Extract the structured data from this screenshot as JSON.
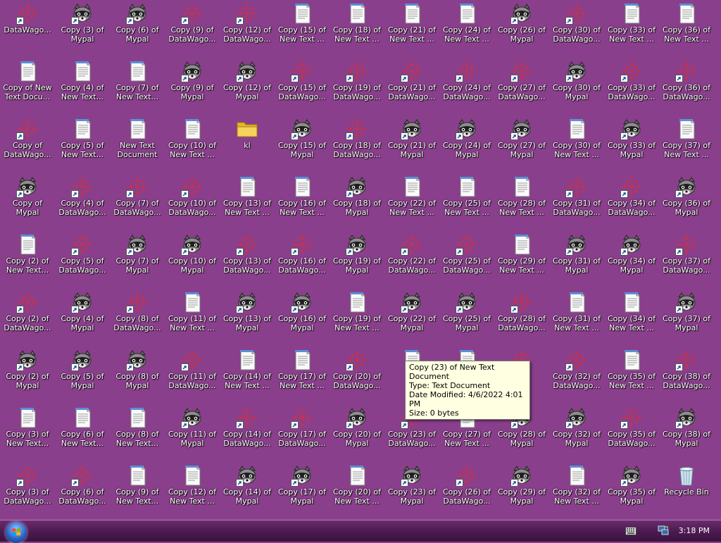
{
  "desktop": {
    "columns": [
      [
        {
          "label": "DataWago...",
          "type": "datawagon"
        },
        {
          "label": "Copy of New Text Docu...",
          "type": "text"
        },
        {
          "label": "Copy of DataWago...",
          "type": "datawagon"
        },
        {
          "label": "Copy of Mypal",
          "type": "mypal"
        },
        {
          "label": "Copy (2) of New Text...",
          "type": "text"
        },
        {
          "label": "Copy (2) of DataWago...",
          "type": "datawagon"
        },
        {
          "label": "Copy (2) of Mypal",
          "type": "mypal"
        },
        {
          "label": "Copy (3) of New Text...",
          "type": "text"
        },
        {
          "label": "Copy (3) of DataWago...",
          "type": "datawagon"
        }
      ],
      [
        {
          "label": "Copy (3) of Mypal",
          "type": "mypal"
        },
        {
          "label": "Copy (4) of New Text...",
          "type": "text"
        },
        {
          "label": "Copy (5) of New Text...",
          "type": "text"
        },
        {
          "label": "Copy (4) of DataWago...",
          "type": "datawagon"
        },
        {
          "label": "Copy (5) of DataWago...",
          "type": "datawagon"
        },
        {
          "label": "Copy (4) of Mypal",
          "type": "mypal"
        },
        {
          "label": "Copy (5) of Mypal",
          "type": "mypal"
        },
        {
          "label": "Copy (6) of New Text...",
          "type": "text"
        },
        {
          "label": "Copy (6) of DataWago...",
          "type": "datawagon"
        }
      ],
      [
        {
          "label": "Copy (6) of Mypal",
          "type": "mypal"
        },
        {
          "label": "Copy (7) of New Text...",
          "type": "text"
        },
        {
          "label": "New Text Document",
          "type": "text"
        },
        {
          "label": "Copy (7) of DataWago...",
          "type": "datawagon"
        },
        {
          "label": "Copy (7) of Mypal",
          "type": "mypal"
        },
        {
          "label": "Copy (8) of DataWago...",
          "type": "datawagon"
        },
        {
          "label": "Copy (8) of Mypal",
          "type": "mypal"
        },
        {
          "label": "Copy (8) of New Text...",
          "type": "text"
        },
        {
          "label": "Copy (9) of New Text...",
          "type": "text"
        }
      ],
      [
        {
          "label": "Copy (9) of DataWago...",
          "type": "datawagon"
        },
        {
          "label": "Copy (9) of Mypal",
          "type": "mypal"
        },
        {
          "label": "Copy (10) of New Text ...",
          "type": "text"
        },
        {
          "label": "Copy (10) of DataWago...",
          "type": "datawagon"
        },
        {
          "label": "Copy (10) of Mypal",
          "type": "mypal"
        },
        {
          "label": "Copy (11) of New Text ...",
          "type": "text"
        },
        {
          "label": "Copy (11) of DataWago...",
          "type": "datawagon"
        },
        {
          "label": "Copy (11) of Mypal",
          "type": "mypal"
        },
        {
          "label": "Copy (12) of New Text ...",
          "type": "text"
        }
      ],
      [
        {
          "label": "Copy (12) of DataWago...",
          "type": "datawagon"
        },
        {
          "label": "Copy (12) of Mypal",
          "type": "mypal"
        },
        {
          "label": "kl",
          "type": "folder"
        },
        {
          "label": "Copy (13) of New Text ...",
          "type": "text"
        },
        {
          "label": "Copy (13) of DataWago...",
          "type": "datawagon"
        },
        {
          "label": "Copy (13) of Mypal",
          "type": "mypal"
        },
        {
          "label": "Copy (14) of New Text ...",
          "type": "text"
        },
        {
          "label": "Copy (14) of DataWago...",
          "type": "datawagon"
        },
        {
          "label": "Copy (14) of Mypal",
          "type": "mypal"
        }
      ],
      [
        {
          "label": "Copy (15) of New Text ...",
          "type": "text"
        },
        {
          "label": "Copy (15) of DataWago...",
          "type": "datawagon"
        },
        {
          "label": "Copy (15) of Mypal",
          "type": "mypal"
        },
        {
          "label": "Copy (16) of New Text ...",
          "type": "text"
        },
        {
          "label": "Copy (16) of DataWago...",
          "type": "datawagon"
        },
        {
          "label": "Copy (16) of Mypal",
          "type": "mypal"
        },
        {
          "label": "Copy (17) of New Text ...",
          "type": "text"
        },
        {
          "label": "Copy (17) of DataWago...",
          "type": "datawagon"
        },
        {
          "label": "Copy (17) of Mypal",
          "type": "mypal"
        }
      ],
      [
        {
          "label": "Copy (18) of New Text ...",
          "type": "text"
        },
        {
          "label": "Copy (19) of DataWago...",
          "type": "datawagon"
        },
        {
          "label": "Copy (18) of DataWago...",
          "type": "datawagon"
        },
        {
          "label": "Copy (18) of Mypal",
          "type": "mypal"
        },
        {
          "label": "Copy (19) of Mypal",
          "type": "mypal"
        },
        {
          "label": "Copy (19) of New Text ...",
          "type": "text"
        },
        {
          "label": "Copy (20) of DataWago...",
          "type": "datawagon"
        },
        {
          "label": "Copy (20) of Mypal",
          "type": "mypal"
        },
        {
          "label": "Copy (20) of New Text ...",
          "type": "text"
        }
      ],
      [
        {
          "label": "Copy (21) of New Text ...",
          "type": "text"
        },
        {
          "label": "Copy (21) of DataWago...",
          "type": "datawagon"
        },
        {
          "label": "Copy (21) of Mypal",
          "type": "mypal"
        },
        {
          "label": "Copy (22) of New Text ...",
          "type": "text"
        },
        {
          "label": "Copy (22) of DataWago...",
          "type": "datawagon"
        },
        {
          "label": "Copy (22) of Mypal",
          "type": "mypal"
        },
        {
          "label": "",
          "type": "text"
        },
        {
          "label": "Copy (23) of DataWago...",
          "type": "datawagon"
        },
        {
          "label": "Copy (23) of Mypal",
          "type": "mypal"
        }
      ],
      [
        {
          "label": "Copy (24) of New Text ...",
          "type": "text"
        },
        {
          "label": "Copy (24) of DataWago...",
          "type": "datawagon"
        },
        {
          "label": "Copy (24) of Mypal",
          "type": "mypal"
        },
        {
          "label": "Copy (25) of New Text ...",
          "type": "text"
        },
        {
          "label": "Copy (25) of DataWago...",
          "type": "datawagon"
        },
        {
          "label": "Copy (25) of Mypal",
          "type": "mypal"
        },
        {
          "label": "",
          "type": "text"
        },
        {
          "label": "Copy (27) of New Text ...",
          "type": "text"
        },
        {
          "label": "Copy (26) of DataWago...",
          "type": "datawagon"
        }
      ],
      [
        {
          "label": "Copy (26) of Mypal",
          "type": "mypal"
        },
        {
          "label": "Copy (27) of DataWago...",
          "type": "datawagon"
        },
        {
          "label": "Copy (27) of Mypal",
          "type": "mypal"
        },
        {
          "label": "Copy (28) of New Text ...",
          "type": "text"
        },
        {
          "label": "Copy (29) of New Text ...",
          "type": "text"
        },
        {
          "label": "Copy (28) of DataWago...",
          "type": "datawagon"
        },
        {
          "label": "",
          "type": "datawagon"
        },
        {
          "label": "Copy (28) of Mypal",
          "type": "mypal"
        },
        {
          "label": "Copy (29) of Mypal",
          "type": "mypal"
        }
      ],
      [
        {
          "label": "Copy (30) of DataWago...",
          "type": "datawagon"
        },
        {
          "label": "Copy (30) of Mypal",
          "type": "mypal"
        },
        {
          "label": "Copy (30) of New Text ...",
          "type": "text"
        },
        {
          "label": "Copy (31) of DataWago...",
          "type": "datawagon"
        },
        {
          "label": "Copy (31) of Mypal",
          "type": "mypal"
        },
        {
          "label": "Copy (31) of New Text ...",
          "type": "text"
        },
        {
          "label": "Copy (32) of DataWago...",
          "type": "datawagon"
        },
        {
          "label": "Copy (32) of Mypal",
          "type": "mypal"
        },
        {
          "label": "Copy (32) of New Text ...",
          "type": "text"
        }
      ],
      [
        {
          "label": "Copy (33) of New Text ...",
          "type": "text"
        },
        {
          "label": "Copy (33) of DataWago...",
          "type": "datawagon"
        },
        {
          "label": "Copy (33) of Mypal",
          "type": "mypal"
        },
        {
          "label": "Copy (34) of DataWago...",
          "type": "datawagon"
        },
        {
          "label": "Copy (34) of Mypal",
          "type": "mypal"
        },
        {
          "label": "Copy (34) of New Text ...",
          "type": "text"
        },
        {
          "label": "Copy (35) of New Text ...",
          "type": "text"
        },
        {
          "label": "Copy (35) of DataWago...",
          "type": "datawagon"
        },
        {
          "label": "Copy (35) of Mypal",
          "type": "mypal"
        }
      ],
      [
        {
          "label": "Copy (36) of New Text ...",
          "type": "text"
        },
        {
          "label": "Copy (36) of DataWago...",
          "type": "datawagon"
        },
        {
          "label": "Copy (37) of New Text ...",
          "type": "text"
        },
        {
          "label": "Copy (36) of Mypal",
          "type": "mypal"
        },
        {
          "label": "Copy (37) of DataWago...",
          "type": "datawagon"
        },
        {
          "label": "Copy (37) of Mypal",
          "type": "mypal"
        },
        {
          "label": "Copy (38) of DataWago...",
          "type": "datawagon"
        },
        {
          "label": "Copy (38) of Mypal",
          "type": "mypal"
        },
        {
          "label": "Recycle Bin",
          "type": "recycle"
        }
      ]
    ]
  },
  "tooltip": {
    "name": "Copy (23) of New Text Document",
    "type": "Type: Text Document",
    "modified": "Date Modified: 4/6/2022 4:01 PM",
    "size": "Size: 0 bytes"
  },
  "taskbar": {
    "clock": "3:18 PM"
  },
  "colors": {
    "desktop_background": "#8a3f8c",
    "taskbar": "#4a1a4e",
    "tooltip_background": "#ffffe1"
  },
  "icons": {
    "text": "text-document-icon",
    "datawagon": "datawagon-icon",
    "mypal": "mypal-raccoon-icon",
    "folder": "folder-icon",
    "recycle": "recycle-bin-icon",
    "start": "windows-orb-icon",
    "keyboard": "keyboard-icon",
    "network": "network-icon"
  }
}
